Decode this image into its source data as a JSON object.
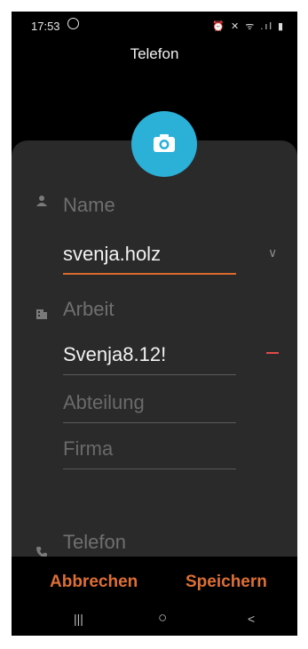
{
  "status_bar": {
    "time": "17:53",
    "icons": "⏰ ✕ ᯤ .ıl ▮"
  },
  "header": {
    "title": "Telefon"
  },
  "form": {
    "name_label": "Name",
    "name_value": "svenja.holz",
    "work_label": "Arbeit",
    "work_value": "Svenja8.12!",
    "department_placeholder": "Abteilung",
    "company_placeholder": "Firma",
    "phone_label": "Telefon"
  },
  "actions": {
    "cancel_label": "Abbrechen",
    "save_label": "Speichern"
  },
  "nav": {
    "recents": "|||",
    "home": "○",
    "back": "<"
  },
  "colors": {
    "accent": "#de6f35",
    "camera": "#2bb0d8",
    "remove": "#e04a4a",
    "card": "#2a2a2a"
  }
}
